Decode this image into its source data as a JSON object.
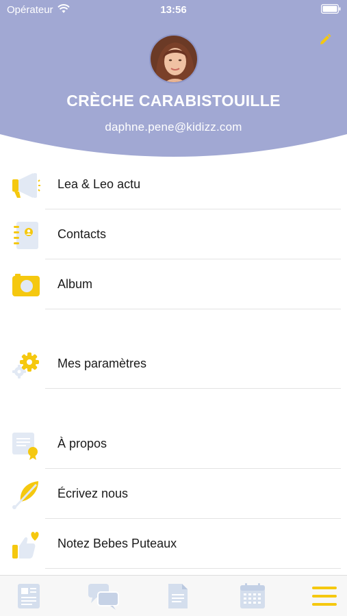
{
  "status_bar": {
    "carrier": "Opérateur",
    "time": "13:56"
  },
  "profile": {
    "name": "CRÈCHE CARABISTOUILLE",
    "email": "daphne.pene@kidizz.com"
  },
  "menu": {
    "items": [
      {
        "label": "Lea & Leo actu",
        "icon": "megaphone-icon"
      },
      {
        "label": "Contacts",
        "icon": "address-book-icon"
      },
      {
        "label": "Album",
        "icon": "camera-icon"
      },
      {
        "label": "Mes paramètres",
        "icon": "gears-icon"
      },
      {
        "label": "À propos",
        "icon": "certificate-icon"
      },
      {
        "label": "Écrivez nous",
        "icon": "feather-icon"
      },
      {
        "label": "Notez Bebes Puteaux",
        "icon": "thumbs-up-heart-icon"
      }
    ]
  },
  "tab_bar": {
    "tabs": [
      {
        "icon": "news-icon",
        "active": false
      },
      {
        "icon": "chat-icon",
        "active": false
      },
      {
        "icon": "document-icon",
        "active": false
      },
      {
        "icon": "calendar-icon",
        "active": false
      },
      {
        "icon": "menu-icon",
        "active": true
      }
    ]
  },
  "colors": {
    "header": "#a1a8d3",
    "accent_yellow": "#f5c80f",
    "icon_light_blue": "#e2e9f4",
    "tab_inactive": "#d4deed"
  }
}
